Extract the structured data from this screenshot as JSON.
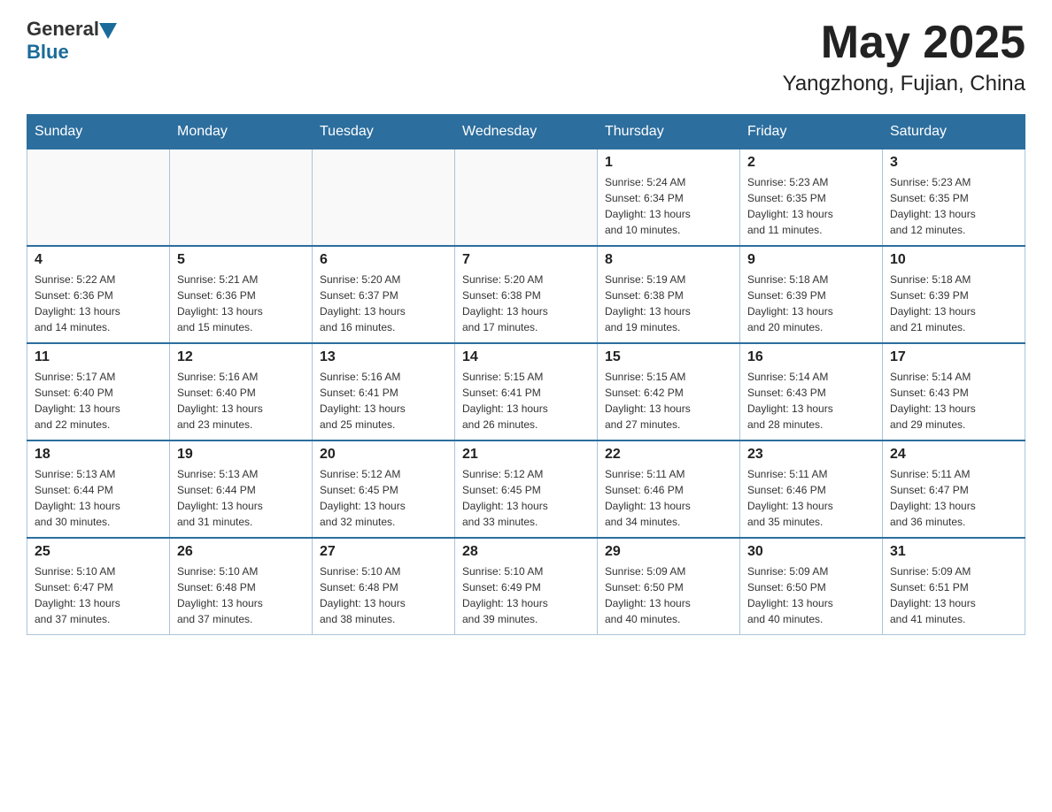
{
  "header": {
    "logo_general": "General",
    "logo_blue": "Blue",
    "title": "May 2025",
    "subtitle": "Yangzhong, Fujian, China"
  },
  "days_of_week": [
    "Sunday",
    "Monday",
    "Tuesday",
    "Wednesday",
    "Thursday",
    "Friday",
    "Saturday"
  ],
  "weeks": [
    [
      {
        "day": "",
        "info": ""
      },
      {
        "day": "",
        "info": ""
      },
      {
        "day": "",
        "info": ""
      },
      {
        "day": "",
        "info": ""
      },
      {
        "day": "1",
        "info": "Sunrise: 5:24 AM\nSunset: 6:34 PM\nDaylight: 13 hours\nand 10 minutes."
      },
      {
        "day": "2",
        "info": "Sunrise: 5:23 AM\nSunset: 6:35 PM\nDaylight: 13 hours\nand 11 minutes."
      },
      {
        "day": "3",
        "info": "Sunrise: 5:23 AM\nSunset: 6:35 PM\nDaylight: 13 hours\nand 12 minutes."
      }
    ],
    [
      {
        "day": "4",
        "info": "Sunrise: 5:22 AM\nSunset: 6:36 PM\nDaylight: 13 hours\nand 14 minutes."
      },
      {
        "day": "5",
        "info": "Sunrise: 5:21 AM\nSunset: 6:36 PM\nDaylight: 13 hours\nand 15 minutes."
      },
      {
        "day": "6",
        "info": "Sunrise: 5:20 AM\nSunset: 6:37 PM\nDaylight: 13 hours\nand 16 minutes."
      },
      {
        "day": "7",
        "info": "Sunrise: 5:20 AM\nSunset: 6:38 PM\nDaylight: 13 hours\nand 17 minutes."
      },
      {
        "day": "8",
        "info": "Sunrise: 5:19 AM\nSunset: 6:38 PM\nDaylight: 13 hours\nand 19 minutes."
      },
      {
        "day": "9",
        "info": "Sunrise: 5:18 AM\nSunset: 6:39 PM\nDaylight: 13 hours\nand 20 minutes."
      },
      {
        "day": "10",
        "info": "Sunrise: 5:18 AM\nSunset: 6:39 PM\nDaylight: 13 hours\nand 21 minutes."
      }
    ],
    [
      {
        "day": "11",
        "info": "Sunrise: 5:17 AM\nSunset: 6:40 PM\nDaylight: 13 hours\nand 22 minutes."
      },
      {
        "day": "12",
        "info": "Sunrise: 5:16 AM\nSunset: 6:40 PM\nDaylight: 13 hours\nand 23 minutes."
      },
      {
        "day": "13",
        "info": "Sunrise: 5:16 AM\nSunset: 6:41 PM\nDaylight: 13 hours\nand 25 minutes."
      },
      {
        "day": "14",
        "info": "Sunrise: 5:15 AM\nSunset: 6:41 PM\nDaylight: 13 hours\nand 26 minutes."
      },
      {
        "day": "15",
        "info": "Sunrise: 5:15 AM\nSunset: 6:42 PM\nDaylight: 13 hours\nand 27 minutes."
      },
      {
        "day": "16",
        "info": "Sunrise: 5:14 AM\nSunset: 6:43 PM\nDaylight: 13 hours\nand 28 minutes."
      },
      {
        "day": "17",
        "info": "Sunrise: 5:14 AM\nSunset: 6:43 PM\nDaylight: 13 hours\nand 29 minutes."
      }
    ],
    [
      {
        "day": "18",
        "info": "Sunrise: 5:13 AM\nSunset: 6:44 PM\nDaylight: 13 hours\nand 30 minutes."
      },
      {
        "day": "19",
        "info": "Sunrise: 5:13 AM\nSunset: 6:44 PM\nDaylight: 13 hours\nand 31 minutes."
      },
      {
        "day": "20",
        "info": "Sunrise: 5:12 AM\nSunset: 6:45 PM\nDaylight: 13 hours\nand 32 minutes."
      },
      {
        "day": "21",
        "info": "Sunrise: 5:12 AM\nSunset: 6:45 PM\nDaylight: 13 hours\nand 33 minutes."
      },
      {
        "day": "22",
        "info": "Sunrise: 5:11 AM\nSunset: 6:46 PM\nDaylight: 13 hours\nand 34 minutes."
      },
      {
        "day": "23",
        "info": "Sunrise: 5:11 AM\nSunset: 6:46 PM\nDaylight: 13 hours\nand 35 minutes."
      },
      {
        "day": "24",
        "info": "Sunrise: 5:11 AM\nSunset: 6:47 PM\nDaylight: 13 hours\nand 36 minutes."
      }
    ],
    [
      {
        "day": "25",
        "info": "Sunrise: 5:10 AM\nSunset: 6:47 PM\nDaylight: 13 hours\nand 37 minutes."
      },
      {
        "day": "26",
        "info": "Sunrise: 5:10 AM\nSunset: 6:48 PM\nDaylight: 13 hours\nand 37 minutes."
      },
      {
        "day": "27",
        "info": "Sunrise: 5:10 AM\nSunset: 6:48 PM\nDaylight: 13 hours\nand 38 minutes."
      },
      {
        "day": "28",
        "info": "Sunrise: 5:10 AM\nSunset: 6:49 PM\nDaylight: 13 hours\nand 39 minutes."
      },
      {
        "day": "29",
        "info": "Sunrise: 5:09 AM\nSunset: 6:50 PM\nDaylight: 13 hours\nand 40 minutes."
      },
      {
        "day": "30",
        "info": "Sunrise: 5:09 AM\nSunset: 6:50 PM\nDaylight: 13 hours\nand 40 minutes."
      },
      {
        "day": "31",
        "info": "Sunrise: 5:09 AM\nSunset: 6:51 PM\nDaylight: 13 hours\nand 41 minutes."
      }
    ]
  ]
}
